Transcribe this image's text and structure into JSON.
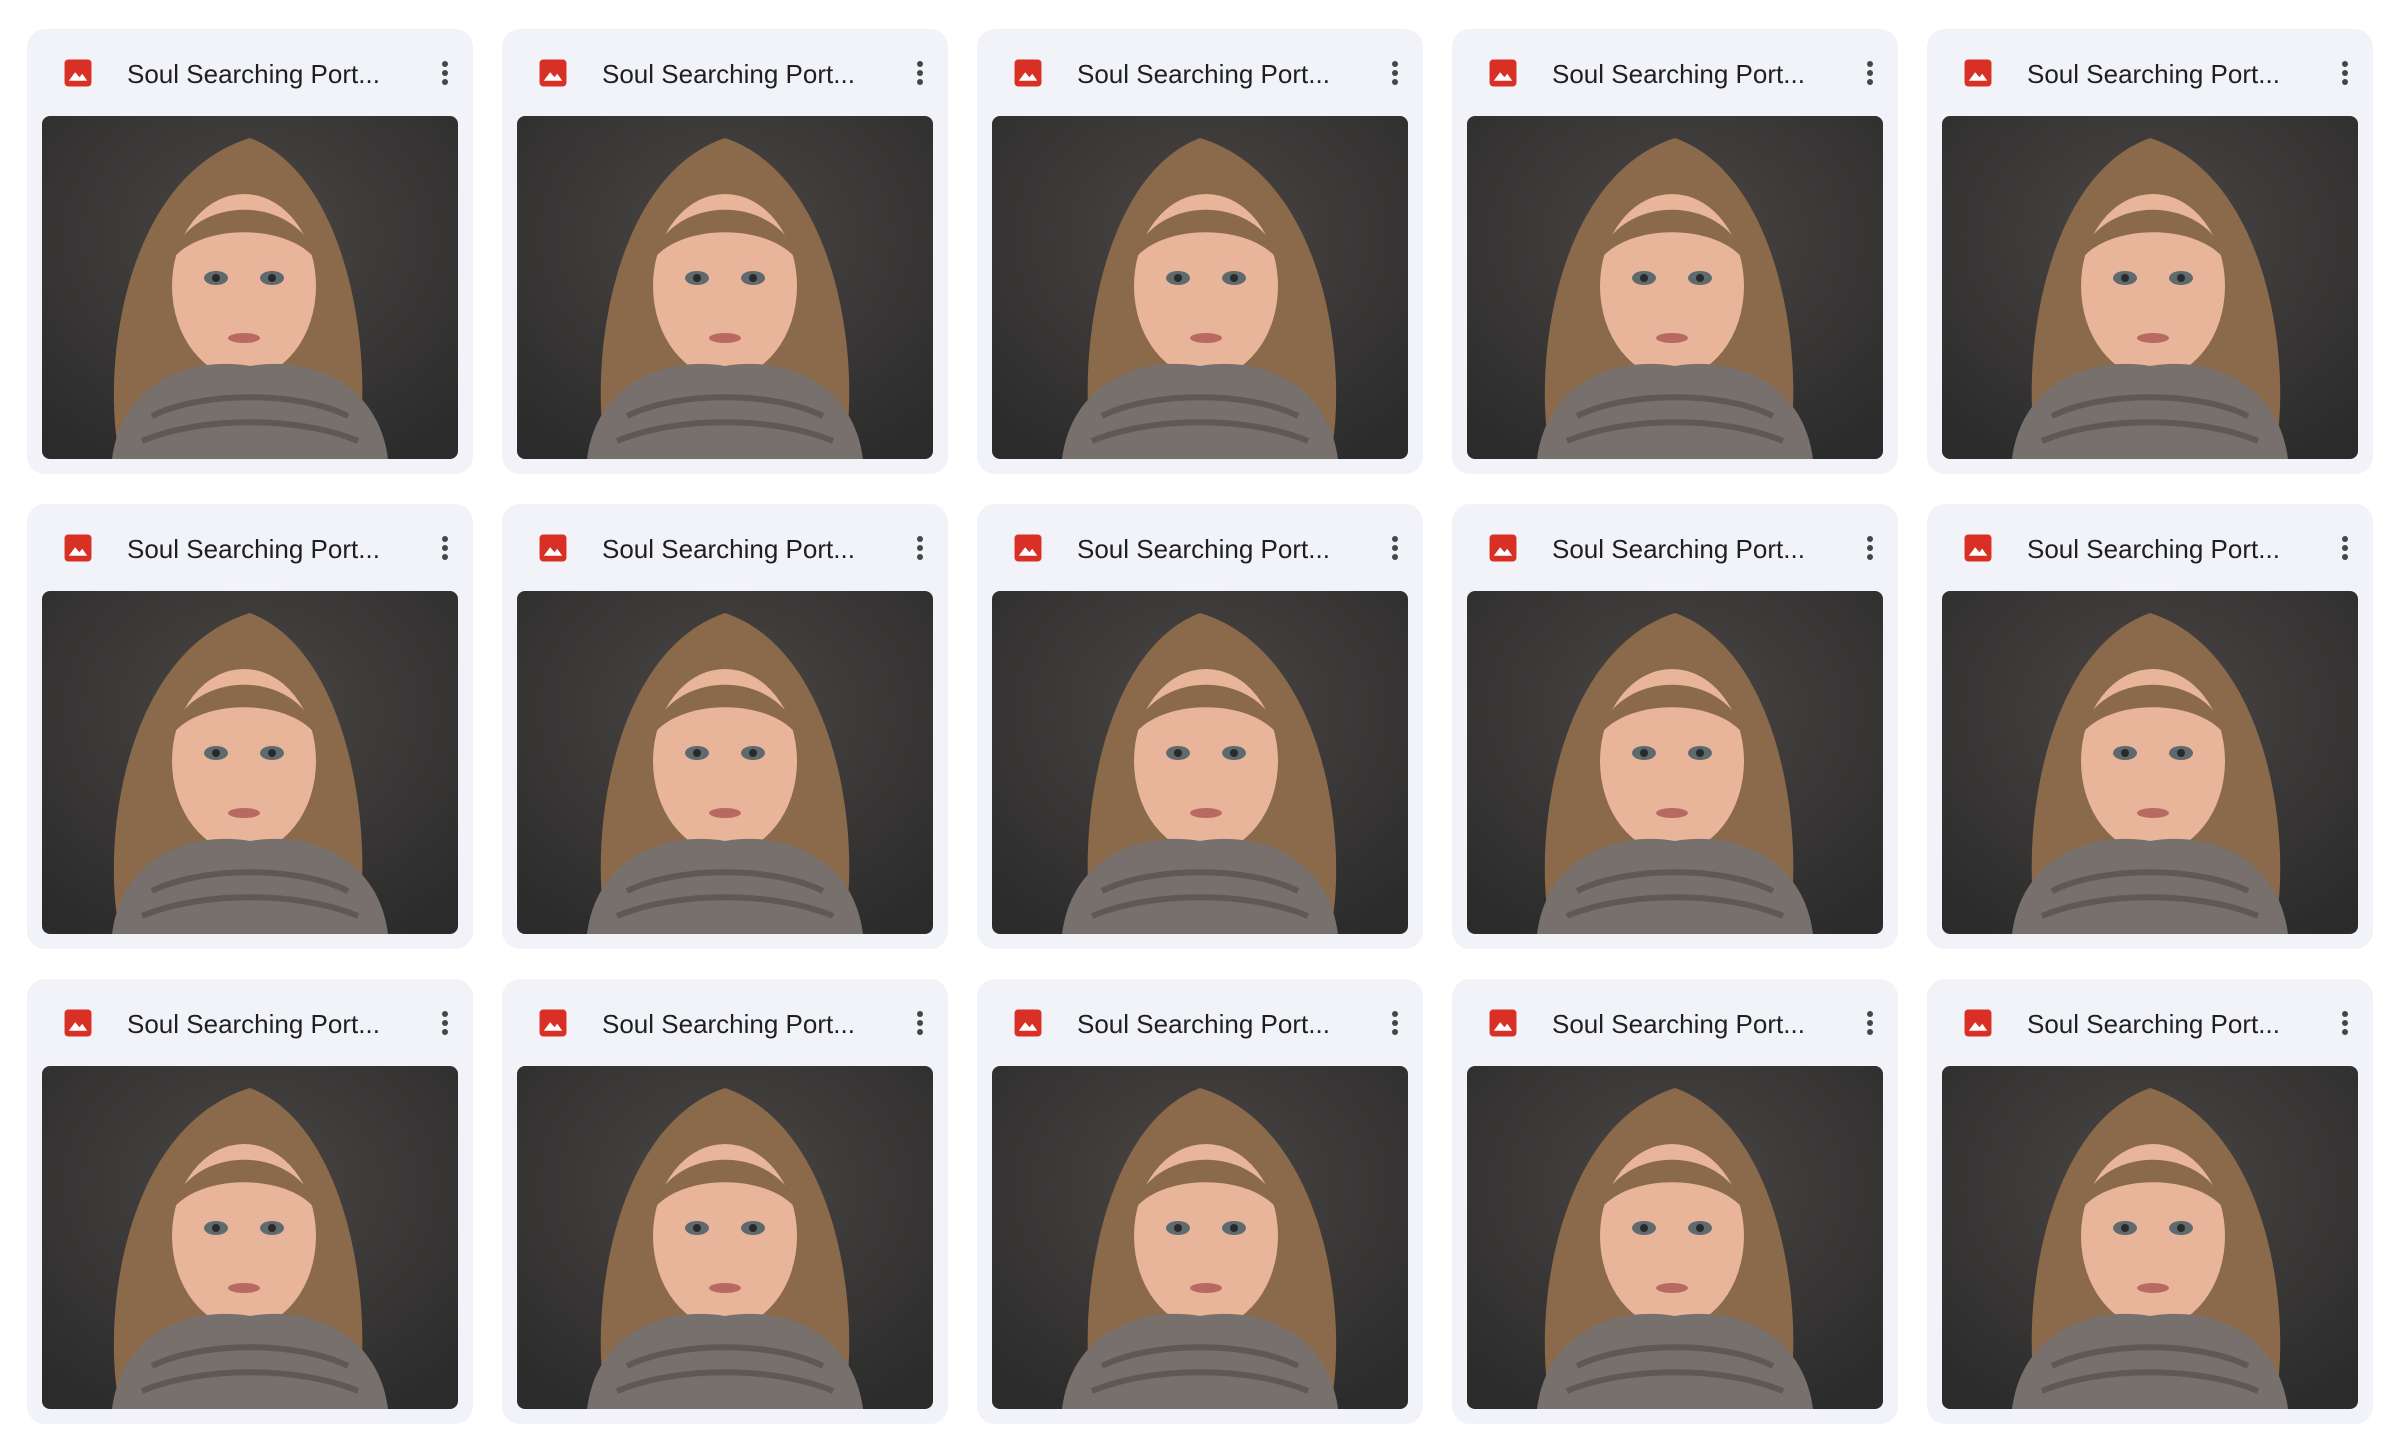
{
  "files": [
    {
      "name": "Soul Searching Port...",
      "icon": "image-file-icon",
      "thumbnail": "portrait-thumbnail"
    },
    {
      "name": "Soul Searching Port...",
      "icon": "image-file-icon",
      "thumbnail": "portrait-thumbnail"
    },
    {
      "name": "Soul Searching Port...",
      "icon": "image-file-icon",
      "thumbnail": "portrait-thumbnail"
    },
    {
      "name": "Soul Searching Port...",
      "icon": "image-file-icon",
      "thumbnail": "portrait-thumbnail"
    },
    {
      "name": "Soul Searching Port...",
      "icon": "image-file-icon",
      "thumbnail": "portrait-thumbnail"
    },
    {
      "name": "Soul Searching Port...",
      "icon": "image-file-icon",
      "thumbnail": "portrait-thumbnail"
    },
    {
      "name": "Soul Searching Port...",
      "icon": "image-file-icon",
      "thumbnail": "portrait-thumbnail"
    },
    {
      "name": "Soul Searching Port...",
      "icon": "image-file-icon",
      "thumbnail": "portrait-thumbnail"
    },
    {
      "name": "Soul Searching Port...",
      "icon": "image-file-icon",
      "thumbnail": "portrait-thumbnail"
    },
    {
      "name": "Soul Searching Port...",
      "icon": "image-file-icon",
      "thumbnail": "portrait-thumbnail"
    },
    {
      "name": "Soul Searching Port...",
      "icon": "image-file-icon",
      "thumbnail": "portrait-thumbnail"
    },
    {
      "name": "Soul Searching Port...",
      "icon": "image-file-icon",
      "thumbnail": "portrait-thumbnail"
    },
    {
      "name": "Soul Searching Port...",
      "icon": "image-file-icon",
      "thumbnail": "portrait-thumbnail"
    },
    {
      "name": "Soul Searching Port...",
      "icon": "image-file-icon",
      "thumbnail": "portrait-thumbnail"
    },
    {
      "name": "Soul Searching Port...",
      "icon": "image-file-icon",
      "thumbnail": "portrait-thumbnail"
    }
  ],
  "colors": {
    "card_background": "#f1f3f8",
    "image_icon_red": "#d93025",
    "title_text": "#1f1f1f",
    "more_icon": "#444746",
    "photo_backdrop": "#2b2b2b",
    "hair": "#8a6a4a",
    "skin": "#e8b49a",
    "scarf": "#77706c"
  }
}
